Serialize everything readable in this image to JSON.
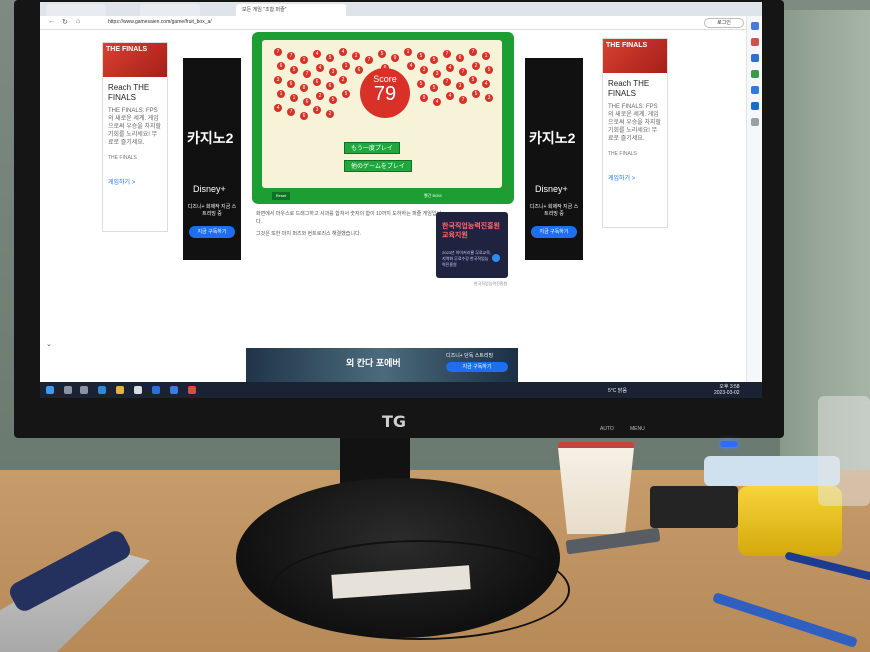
{
  "browser": {
    "tabs": [
      "",
      "",
      "모든 게임 \"조합 퍼즐\""
    ],
    "url": "https://www.gamesaien.com/game/fruit_box_a/",
    "profile": "로그인"
  },
  "ads": {
    "left_card": {
      "thumb": "THE FINALS",
      "title": "Reach THE FINALS",
      "body": "THE FINALS: FPS의 새로운 세계. 게임으로써 우승을 차지할 기회를 노리세요! 무료로 즐기세요.",
      "brand": "THE FINALS",
      "link": "게임하기 >"
    },
    "right_card": {
      "thumb": "THE FINALS",
      "title": "Reach THE FINALS",
      "body": "THE FINALS: FPS의 새로운 세계. 게임으로써 우승을 차지할 기회를 노리세요! 무료로 즐기세요.",
      "brand": "THE FINALS",
      "link": "게임하기 >"
    },
    "tall_left": {
      "title": "카지노2",
      "brand": "Disney+",
      "sub": "디즈니+ 회제작 지금 스트리밍 중",
      "cta": "지금 구독하기"
    },
    "tall_right": {
      "title": "카지노2",
      "brand": "Disney+",
      "sub": "디즈니+ 회제작 지금 스트리밍 중",
      "cta": "지금 구독하기"
    },
    "square": {
      "headline": "한국직업능력진흥원 교육지원",
      "body": "2023년 하이커리큘 무료교육, 지역화 무료수강 한국직업능력진흥원",
      "caption": "한국직업능력진흥원"
    },
    "banner": {
      "title": "외 칸다 포에버",
      "sub": "디즈니+ 단독 스트리밍",
      "cta": "지금 구독하기"
    }
  },
  "game": {
    "score_label": "Score",
    "score": "79",
    "btn_again": "もう一度プレイ",
    "btn_other": "他のゲームをプレイ",
    "reset": "Reset",
    "legend": "빨간 BGM",
    "cells": [
      "7",
      "7",
      "1",
      "4",
      "5",
      "4",
      "2",
      "7",
      "5",
      "9",
      "1",
      "5",
      "5",
      "7",
      "6",
      "7",
      "1",
      "6",
      "5",
      "7",
      "4",
      "3",
      "1",
      "6",
      "4",
      "6",
      "2",
      "4",
      "3",
      "3",
      "4",
      "7",
      "2",
      "5",
      "3",
      "6",
      "8",
      "6",
      "6",
      "2",
      "7",
      "9",
      "6",
      "8",
      "6",
      "5",
      "5",
      "7",
      "3",
      "5",
      "4",
      "1",
      "1",
      "6",
      "2",
      "5",
      "5",
      "6",
      "3",
      "6",
      "7",
      "4",
      "9",
      "4",
      "4",
      "7",
      "5",
      "3",
      "4",
      "7",
      "6",
      "3",
      "2"
    ],
    "desc1": "화면에서 마우스로 드래그하고 사과를 합쳐서 숫자의 합이 10까지 도하하는 퍼즐 게임입니다.",
    "desc2": "그것은 또한 마지 퍼즈와 현트로리스 해결했습니다."
  },
  "taskbar": {
    "weather": "5°C 맑음",
    "time": "오후 3:58",
    "date": "2023-03-02"
  },
  "monitor": {
    "logo": "TG",
    "auto": "AUTO",
    "menu": "MENU"
  }
}
